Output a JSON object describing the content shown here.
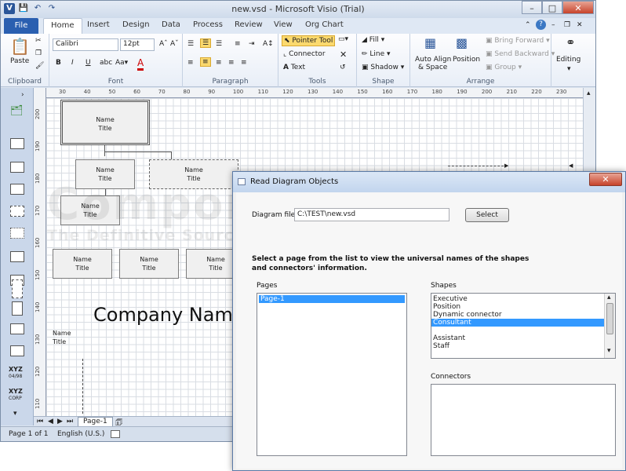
{
  "visio": {
    "title": "new.vsd - Microsoft Visio (Trial)",
    "tabs": [
      "File",
      "Home",
      "Insert",
      "Design",
      "Data",
      "Process",
      "Review",
      "View",
      "Org Chart"
    ],
    "ribbon": {
      "paste": "Paste",
      "clipboard": "Clipboard",
      "font_name": "Calibri",
      "font_size": "12pt",
      "font": "Font",
      "paragraph": "Paragraph",
      "pointer_tool": "Pointer Tool",
      "connector": "Connector",
      "text": "Text",
      "tools": "Tools",
      "fill": "Fill",
      "line": "Line",
      "shadow": "Shadow",
      "shape": "Shape",
      "auto_align": "Auto Align",
      "and_space": "& Space",
      "position": "Position",
      "bring_forward": "Bring Forward",
      "send_backward": "Send Backward",
      "group": "Group",
      "arrange": "Arrange",
      "editing": "Editing"
    },
    "hruler": [
      "30",
      "40",
      "50",
      "60",
      "70",
      "80",
      "90",
      "100",
      "110",
      "120",
      "130",
      "140",
      "150",
      "160",
      "170",
      "180",
      "190",
      "200",
      "210",
      "220",
      "230"
    ],
    "vruler": [
      "200",
      "190",
      "180",
      "170",
      "160",
      "150",
      "140",
      "130",
      "120",
      "110"
    ],
    "shapes": [
      {
        "name": "Name",
        "title": "Title"
      },
      {
        "name": "Name",
        "title": "Title"
      },
      {
        "name": "Name",
        "title": "Title"
      },
      {
        "name": "Name",
        "title": "Title"
      },
      {
        "name": "Name",
        "title": "Title"
      },
      {
        "name": "Name",
        "title": "Title"
      },
      {
        "name": "Name",
        "title": "Title"
      },
      {
        "name": "Name",
        "title": "Title"
      }
    ],
    "company_name": "Company Name",
    "sheet_tab": "Page-1",
    "status_page": "Page 1 of 1",
    "status_lang": "English (U.S.)",
    "stencil_xyz": "XYZ",
    "stencil_date": "04/98",
    "stencil_corp": "CORP"
  },
  "dialog": {
    "title": "Read Diagram Objects",
    "diagram_file_label": "Diagram file:",
    "diagram_file_value": "C:\\TEST\\new.vsd",
    "select_button": "Select",
    "instruction_line1": "Select a page from the list to view the universal names of the shapes",
    "instruction_line2": "and connectors' information.",
    "pages_label": "Pages",
    "pages": [
      "Page-1"
    ],
    "shapes_label": "Shapes",
    "shapes": [
      "Executive",
      "Position",
      "Dynamic connector",
      "Consultant",
      "",
      "Assistant",
      "Staff"
    ],
    "selected_shape": "Consultant",
    "connectors_label": "Connectors"
  },
  "watermark": {
    "line1": "ComponentSource",
    "line2": "The Definitive Source of Software Components"
  }
}
